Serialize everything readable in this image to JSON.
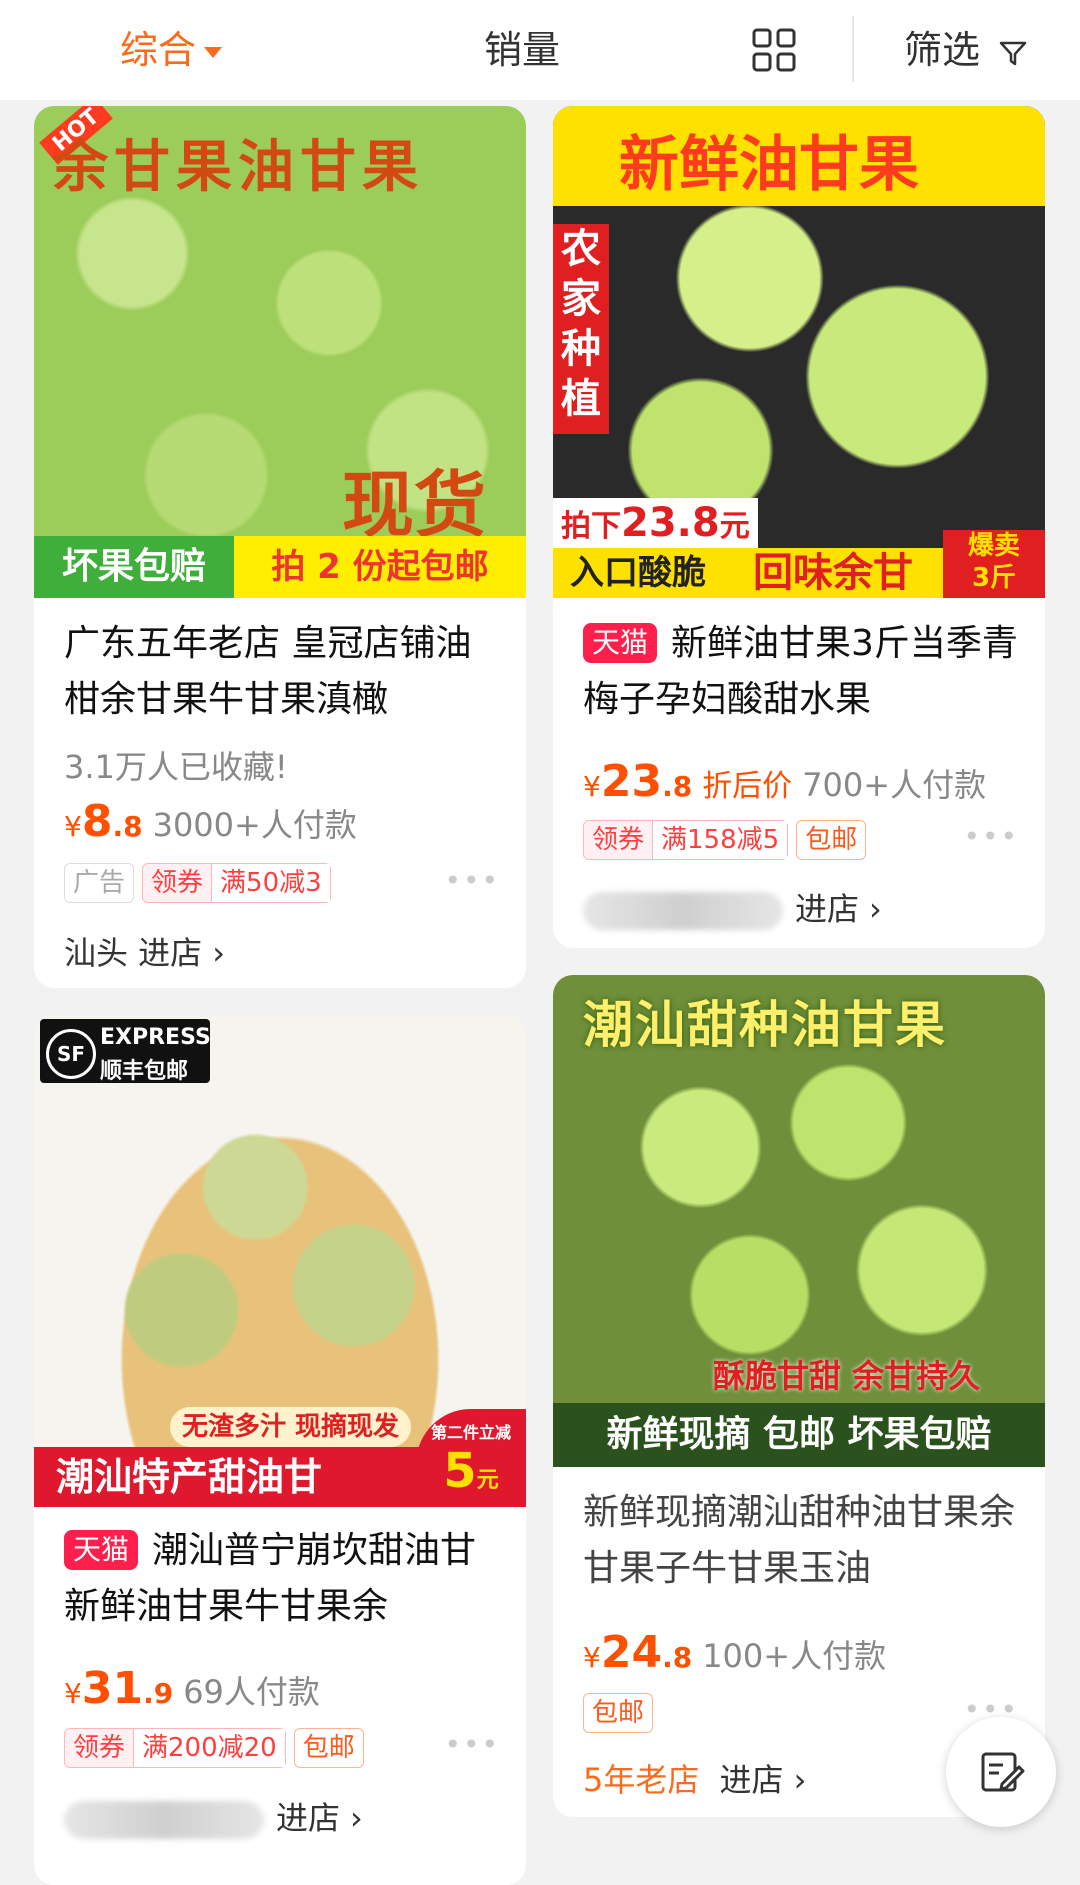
{
  "sort_bar": {
    "comprehensive": "综合",
    "sales": "销量",
    "filter": "筛选"
  },
  "products": [
    {
      "image_text": {
        "hot": "HOT",
        "headline": "余甘果油甘果",
        "stock": "现货",
        "badge_left": "坏果包赔",
        "badge_right": "拍 2 份起包邮"
      },
      "title": "广东五年老店 皇冠店铺油柑余甘果牛甘果滇橄",
      "favorites": "3.1万人已收藏!",
      "price_symbol": "¥",
      "price_int": "8",
      "price_dec": ".8",
      "paid": "3000+人付款",
      "tags": {
        "ad": "广告",
        "coupon": "领券",
        "deal": "满50减3"
      },
      "store": "汕头 进店",
      "arrow": "›",
      "more": "•••"
    },
    {
      "image_text": {
        "headline": "新鲜油甘果",
        "side": "农家种植",
        "price_cut_prefix": "拍下",
        "price_cut_value": "23.8",
        "price_cut_unit": "元",
        "crisp": "入口酸脆",
        "sweet": "回味余甘",
        "hot_sell_1": "爆卖",
        "hot_sell_2": "3斤"
      },
      "tmall": "天猫",
      "title": "新鲜油甘果3斤当季青梅子孕妇酸甜水果",
      "price_symbol": "¥",
      "price_int": "23",
      "price_dec": ".8",
      "discount_label": "折后价",
      "paid": "700+人付款",
      "tags": {
        "coupon": "领券",
        "deal": "满158减5",
        "shipping": "包邮"
      },
      "store": "进店",
      "arrow": "›",
      "more": "•••"
    },
    {
      "image_text": {
        "sf_logo": "SF",
        "sf_express": "EXPRESS",
        "sf_free": "顺丰包邮",
        "juicy": "无渣多汁 现摘现发",
        "second": "第二件立减",
        "amount": "5",
        "unit": "元",
        "banner": "潮汕特产甜油甘"
      },
      "tmall": "天猫",
      "title": "潮汕普宁崩坎甜油甘新鲜油甘果牛甘果余",
      "price_symbol": "¥",
      "price_int": "31",
      "price_dec": ".9",
      "paid": "69人付款",
      "tags": {
        "coupon": "领券",
        "deal": "满200减20",
        "shipping": "包邮"
      },
      "store": "进店",
      "arrow": "›",
      "more": "•••"
    },
    {
      "image_text": {
        "headline": "潮汕甜种油甘果",
        "crisp": "酥脆甘甜 余甘持久",
        "banner": "新鲜现摘 包邮 坏果包赔"
      },
      "title": "新鲜现摘潮汕甜种油甘果余甘果子牛甘果玉油",
      "price_symbol": "¥",
      "price_int": "24",
      "price_dec": ".8",
      "paid": "100+人付款",
      "tags": {
        "shipping": "包邮"
      },
      "store_label": "5年老店",
      "store": "进店",
      "arrow": "›",
      "more": "•••"
    }
  ],
  "colors": {
    "accent": "#ff6a1a",
    "price": "#ff4f00",
    "tmall": "#ff1f4d",
    "fruit_green": "#a9d46a"
  }
}
